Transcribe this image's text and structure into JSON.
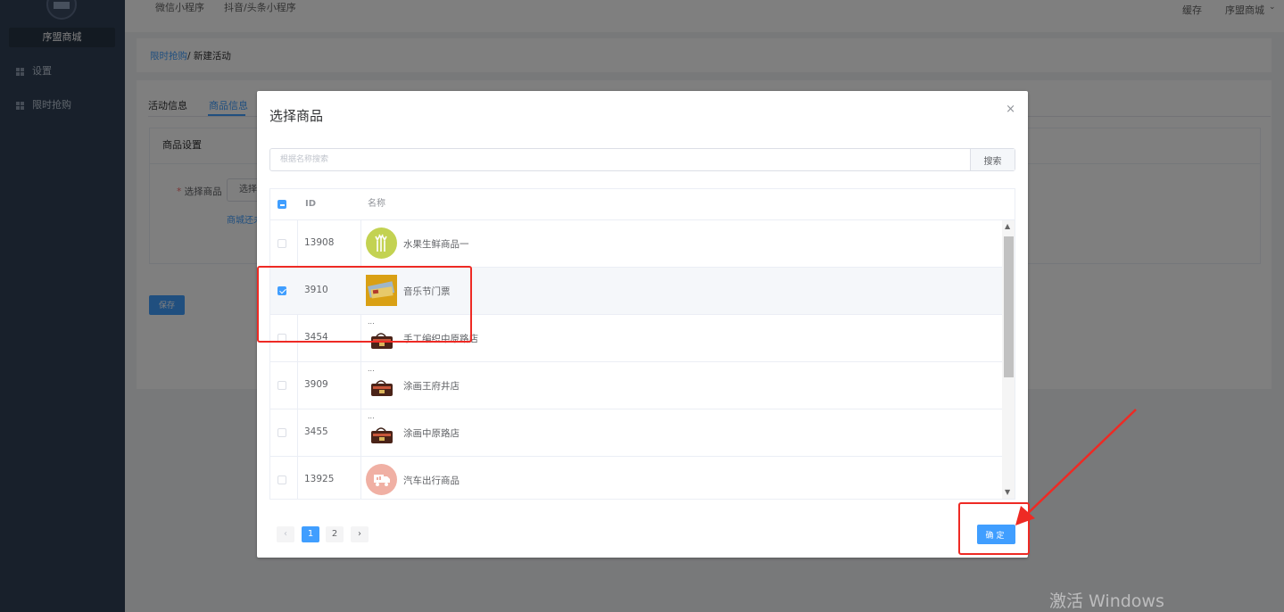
{
  "sidebar": {
    "brand": "序盟商城",
    "items": [
      {
        "label": "设置"
      },
      {
        "label": "限时抢购"
      }
    ]
  },
  "topbar": {
    "tabs": [
      {
        "label": "微信小程序"
      },
      {
        "label": "抖音/头条小程序"
      }
    ],
    "cache": "缓存",
    "user": "序盟商城"
  },
  "breadcrumb": {
    "parent": "限时抢购",
    "current": "新建活动"
  },
  "page": {
    "tabs": [
      {
        "label": "活动信息"
      },
      {
        "label": "商品信息"
      }
    ],
    "section_title": "商品设置",
    "select_label": "选择商品",
    "select_btn": "选择",
    "hint": "商城还未",
    "save": "保存"
  },
  "dialog": {
    "title": "选择商品",
    "close": "×",
    "search": {
      "placeholder": "根据名称搜索",
      "button": "搜索"
    },
    "table": {
      "headers": {
        "id": "ID",
        "name": "名称"
      },
      "rows": [
        {
          "id": "13908",
          "name": "水果生鲜商品一",
          "checked": false,
          "thumb": "wheat-icon"
        },
        {
          "id": "3910",
          "name": "音乐节门票",
          "checked": true,
          "thumb": "ticket-image"
        },
        {
          "id": "3454",
          "name": "手工编织中原路店",
          "checked": false,
          "thumb": "bag-image"
        },
        {
          "id": "3909",
          "name": "涂画王府井店",
          "checked": false,
          "thumb": "bag-image"
        },
        {
          "id": "3455",
          "name": "涂画中原路店",
          "checked": false,
          "thumb": "bag-image"
        },
        {
          "id": "13925",
          "name": "汽车出行商品",
          "checked": false,
          "thumb": "truck-icon"
        }
      ]
    },
    "pagination": {
      "pages": [
        "1",
        "2"
      ],
      "current": "1",
      "prev": "‹",
      "next": "›"
    },
    "confirm": "确定"
  },
  "watermark": "激活 Windows",
  "colors": {
    "primary": "#409eff",
    "sidebar": "#304156",
    "annotation": "#ee2a24"
  }
}
